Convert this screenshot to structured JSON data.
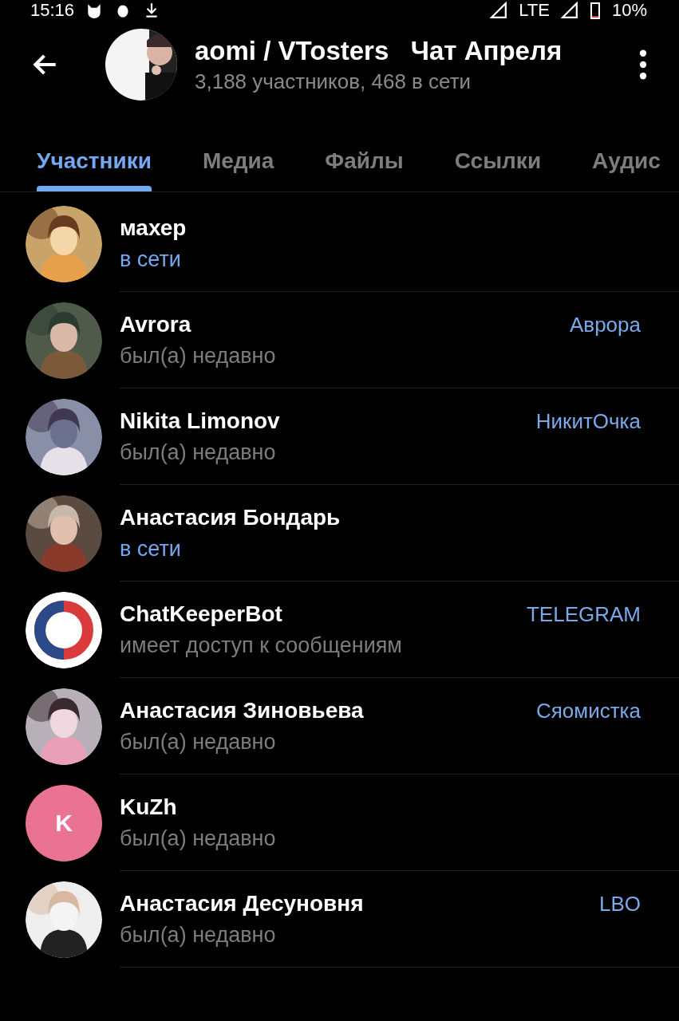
{
  "status_bar": {
    "time": "15:16",
    "network": "LTE",
    "battery": "10%"
  },
  "header": {
    "title": "aomi / VTosters   Чат Апреля",
    "subtitle": "3,188 участников, 468 в сети"
  },
  "tabs": [
    {
      "label": "Участники",
      "selected": true
    },
    {
      "label": "Медиа",
      "selected": false
    },
    {
      "label": "Файлы",
      "selected": false
    },
    {
      "label": "Ссылки",
      "selected": false
    },
    {
      "label": "Аудис",
      "selected": false
    }
  ],
  "members": [
    {
      "name": "махер",
      "status": "в сети",
      "online": true
    },
    {
      "name": "Avrora",
      "status": "был(а) недавно",
      "online": false,
      "role": "Аврора"
    },
    {
      "name": "Nikita Limonov",
      "status": "был(а) недавно",
      "online": false,
      "role": "НикитОчка"
    },
    {
      "name": "Анастасия Бондарь",
      "status": "в сети",
      "online": true
    },
    {
      "name": "ChatKeeperBot",
      "status": "имеет доступ к сообщениям",
      "online": false,
      "role": "TELEGRAM",
      "avatar": {
        "kind": "logo"
      }
    },
    {
      "name": "Анастасия Зиновьева",
      "status": "был(а) недавно",
      "online": false,
      "role": "Сяомистка"
    },
    {
      "name": "KuZh",
      "status": "был(а) недавно",
      "online": false,
      "avatar": {
        "kind": "letter",
        "letter": "K",
        "color": "#ea7393"
      }
    },
    {
      "name": "Анастасия Десуновня",
      "status": "был(а) недавно",
      "online": false,
      "role": "LBO"
    }
  ]
}
